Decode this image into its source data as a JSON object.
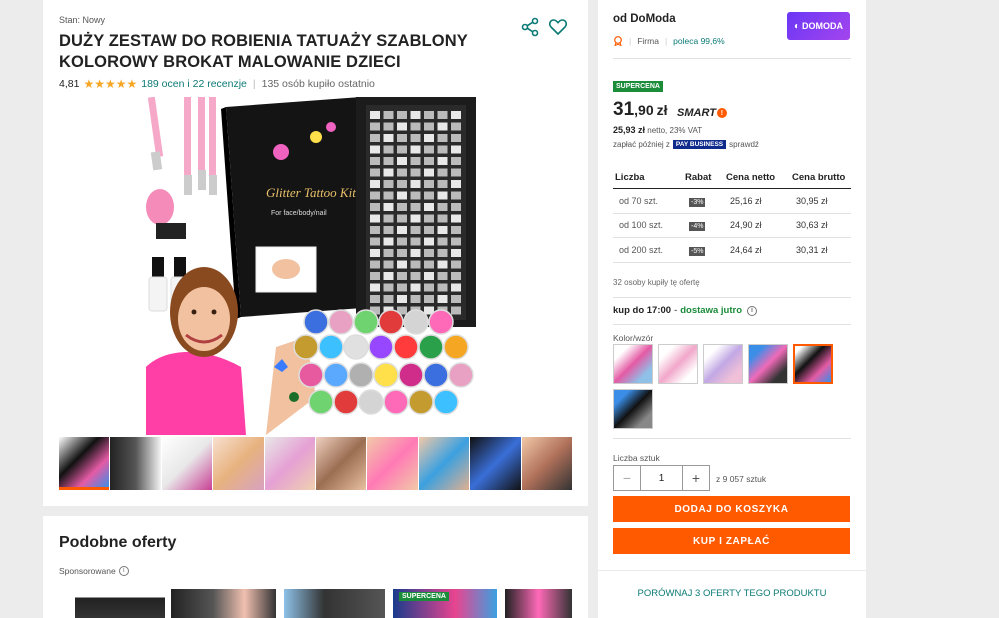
{
  "product": {
    "condition": "Stan: Nowy",
    "title": "DUŻY ZESTAW DO ROBIENIA TATUAŻY SZABLONY KOLOROWY BROKAT MALOWANIE DZIECI",
    "rating": "4,81",
    "stars": "★★★★★",
    "reviews_link": "189 ocen i 22 recenzje",
    "bought_recently": "135 osób kupiło ostatnio",
    "image_box_text": "Glitter Tattoo Kit",
    "image_box_subtext": "For face/body/nail"
  },
  "similar": {
    "title": "Podobne oferty",
    "sponsored": "Sponsorowane",
    "supercena_badge": "SUPERCENA"
  },
  "seller": {
    "label": "od DoModa",
    "logo_text": "DOMODA",
    "type": "Firma",
    "recommends": "poleca 99,6%"
  },
  "pricing": {
    "badge": "SUPERCENA",
    "price_int": "31",
    "price_dec": ",90",
    "currency": "zł",
    "smart_label": "SMART",
    "smart_mark": "!",
    "netto_value": "25,93 zł",
    "netto_text": "netto, 23% VAT",
    "paylater_prefix": "zapłać później z",
    "paylater_badge": "PAY BUSINESS",
    "paylater_suffix": "sprawdź"
  },
  "tiers": {
    "headers": [
      "Liczba",
      "Rabat",
      "Cena netto",
      "Cena brutto"
    ],
    "rows": [
      {
        "qty": "od 70 szt.",
        "discount": "-3%",
        "netto": "25,16 zł",
        "brutto": "30,95 zł"
      },
      {
        "qty": "od 100 szt.",
        "discount": "-4%",
        "netto": "24,90 zł",
        "brutto": "30,63 zł"
      },
      {
        "qty": "od 200 szt.",
        "discount": "-5%",
        "netto": "24,64 zł",
        "brutto": "30,31 zł"
      }
    ]
  },
  "purchase": {
    "bought_offer": "32 osoby kupiły tę ofertę",
    "delivery_prefix": "kup do 17:00",
    "delivery_dash": " - ",
    "delivery_green": "dostawa jutro",
    "color_label": "Kolor/wzór",
    "qty_label": "Liczba sztuk",
    "qty_value": "1",
    "stock": "z 9 057 sztuk",
    "add_to_cart": "DODAJ DO KOSZYKA",
    "buy_now": "KUP I ZAPŁAĆ"
  },
  "compare": {
    "label": "PORÓWNAJ 3 OFERTY TEGO PRODUKTU"
  },
  "colors": {
    "accent": "#ff5a00",
    "link": "#0b7a75",
    "supercena": "#1a8c3a"
  }
}
